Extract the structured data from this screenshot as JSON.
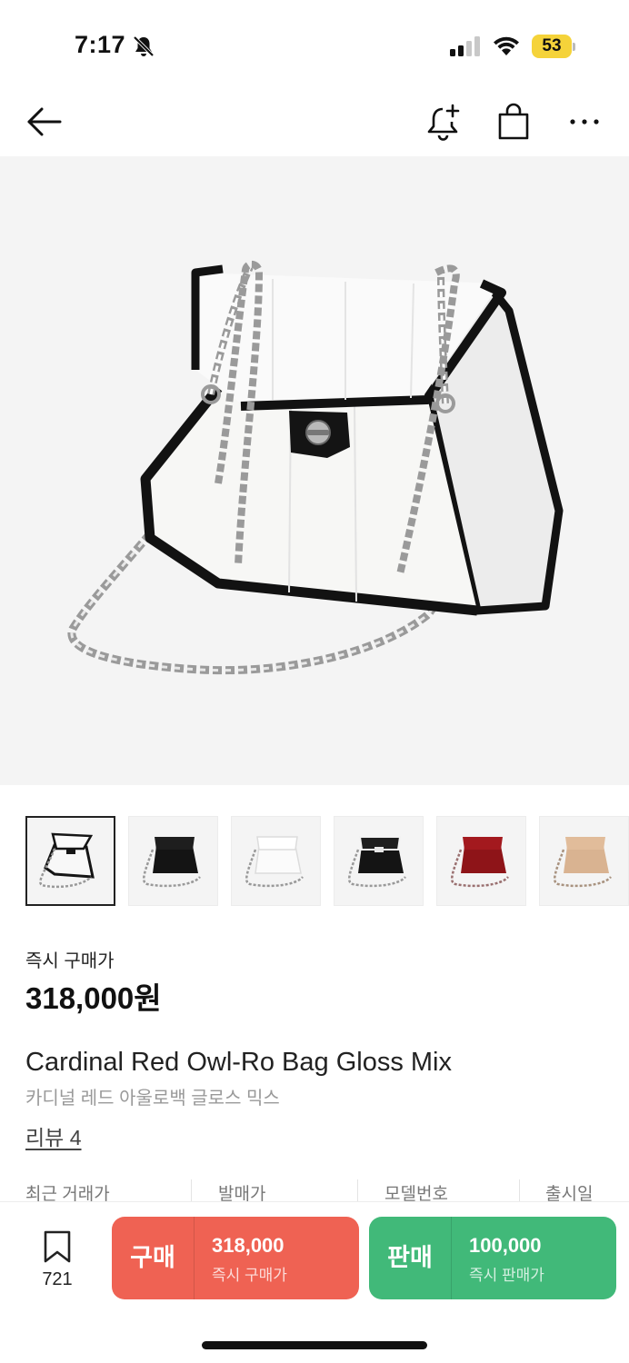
{
  "status_bar": {
    "time": "7:17",
    "battery": "53",
    "icons": [
      "bell-slash-icon",
      "cellular-signal-icon",
      "wifi-icon",
      "battery-icon"
    ]
  },
  "header": {
    "icons": [
      "back-arrow-icon",
      "bell-add-icon",
      "shopping-bag-icon",
      "more-icon"
    ]
  },
  "thumbnails": [
    {
      "variant": "white-black-trim",
      "selected": true
    },
    {
      "variant": "black",
      "selected": false
    },
    {
      "variant": "white",
      "selected": false
    },
    {
      "variant": "black-white-trim",
      "selected": false
    },
    {
      "variant": "red",
      "selected": false
    },
    {
      "variant": "beige",
      "selected": false
    }
  ],
  "price": {
    "label": "즉시 구매가",
    "value": "318,000원"
  },
  "product": {
    "name": "Cardinal Red Owl-Ro Bag Gloss Mix",
    "name_ko": "카디널 레드 아울로백 글로스 믹스",
    "review_link": "리뷰 4"
  },
  "info_labels": [
    "최근 거래가",
    "발매가",
    "모델번호",
    "출시일"
  ],
  "bottom_bar": {
    "wish_count": "721",
    "buy": {
      "label": "구매",
      "price": "318,000",
      "sub": "즉시 구매가"
    },
    "sell": {
      "label": "판매",
      "price": "100,000",
      "sub": "즉시 판매가"
    }
  },
  "colors": {
    "buy": "#ef6253",
    "sell": "#41b979",
    "battery": "#f5d33a",
    "image_bg": "#f4f4f4"
  }
}
